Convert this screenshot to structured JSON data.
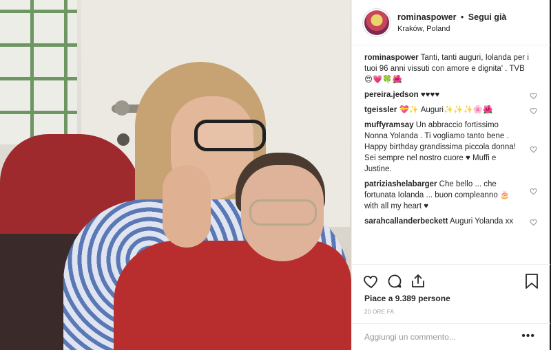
{
  "header": {
    "username": "rominaspower",
    "separator": "•",
    "follow_label": "Segui già",
    "location": "Kraków, Poland"
  },
  "caption": {
    "username": "rominaspower",
    "text": "Tanti, tanti auguri, Iolanda per i tuoi 96 anni vissuti con amore e dignita' . TVB 😍💗🍀🌺"
  },
  "comments": [
    {
      "username": "pereira.jedson",
      "text": "♥♥♥♥"
    },
    {
      "username": "tgeissler",
      "text": "💝✨ Auguri✨✨✨🌸🌺"
    },
    {
      "username": "muffyramsay",
      "text": "Un abbraccio fortissimo Nonna Yolanda . Ti vogliamo tanto bene . Happy birthday grandissima piccola donna! Sei sempre nel nostro cuore ♥ Muffi e Justine."
    },
    {
      "username": "patriziashelabarger",
      "text": "Che bello ... che fortunata Iolanda ... buon compleanno 🎂 with all my heart ♥"
    },
    {
      "username": "sarahcallanderbeckett",
      "text": "Auguri Yolanda xx"
    }
  ],
  "actions": {
    "likes": "Piace a 9.389 persone",
    "time": "20 ORE FA"
  },
  "add_comment": {
    "placeholder": "Aggiungi un commento...",
    "more": "•••"
  },
  "icons": [
    "heart-icon",
    "comment-icon",
    "share-icon",
    "bookmark-icon",
    "small-heart-icon",
    "more-options-icon"
  ]
}
